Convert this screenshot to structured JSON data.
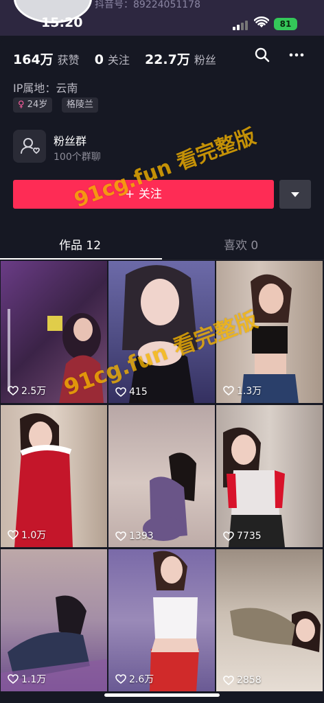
{
  "status_bar": {
    "time": "15:20",
    "battery": "81"
  },
  "profile": {
    "douyin_id": "抖音号：89224051178",
    "stats": [
      {
        "num": "164万",
        "label": "获赞"
      },
      {
        "num": "0",
        "label": "关注"
      },
      {
        "num": "22.7万",
        "label": "粉丝"
      }
    ],
    "ip_location": "IP属地：云南",
    "tags": [
      "24岁",
      "格陵兰"
    ],
    "fan_group": {
      "title": "粉丝群",
      "subtitle": "100个群聊"
    },
    "follow_label": "+ 关注"
  },
  "tabs": [
    {
      "label": "作品 12",
      "active": true
    },
    {
      "label": "喜欢 0",
      "active": false
    }
  ],
  "videos": [
    {
      "likes": "2.5万"
    },
    {
      "likes": "415"
    },
    {
      "likes": "1.3万"
    },
    {
      "likes": "1.0万"
    },
    {
      "likes": "1393"
    },
    {
      "likes": "7735"
    },
    {
      "likes": "1.1万"
    },
    {
      "likes": "2.6万"
    },
    {
      "likes": "2858"
    }
  ],
  "watermarks": {
    "top": "91cg.fun 看完整版",
    "middle": "91cg.fun 看完整版"
  },
  "colors": {
    "accent": "#fe2c55",
    "background": "#161823",
    "header": "#2d2740"
  }
}
